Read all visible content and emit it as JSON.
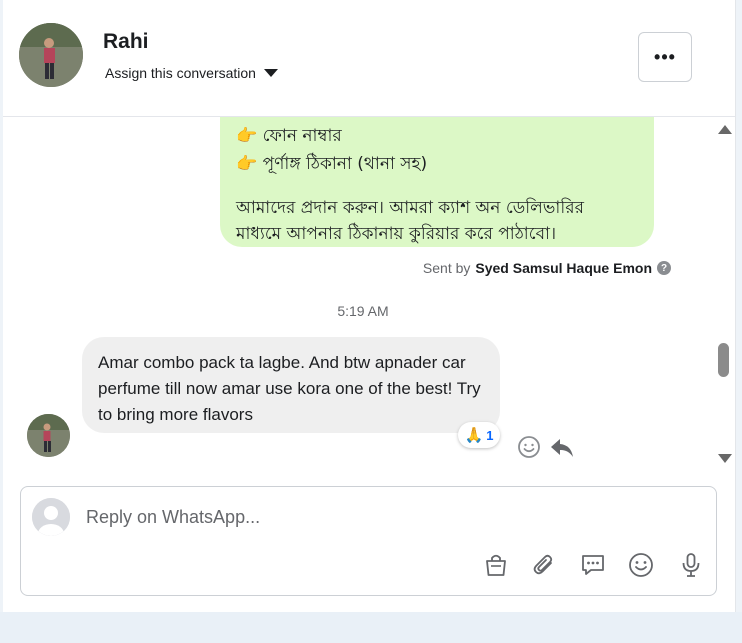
{
  "contact": {
    "name": "Rahi",
    "assign_label": "Assign this conversation"
  },
  "header": {
    "more_label": "•••"
  },
  "outgoing": {
    "line1": "👉 ফোন নাম্বার",
    "line2": "👉  পূর্ণাঙ্গ ঠিকানা (থানা সহ)",
    "line3": "আমাদের প্রদান করুন। আমরা ক্যাশ অন ডেলিভারির",
    "line4": "মাধ্যমে আপনার ঠিকানায় কুরিয়ার করে পাঠাবো।",
    "sent_by_prefix": "Sent by",
    "sent_by_name": "Syed Samsul Haque Emon",
    "help_symbol": "?"
  },
  "timestamp": "5:19 AM",
  "incoming": {
    "text": "Amar combo pack ta lagbe. And btw apnader car perfume till now amar use kora one of the best! Try to bring more flavors",
    "reaction_emoji": "🙏",
    "reaction_count": "1"
  },
  "composer": {
    "placeholder": "Reply on WhatsApp..."
  },
  "colors": {
    "outgoing_bubble": "#dcf8c6",
    "incoming_bubble": "#efefef"
  },
  "icons": [
    "chevron-down-icon",
    "more-icon",
    "help-icon",
    "react-smile-icon",
    "reply-icon",
    "shopping-bag-icon",
    "paperclip-icon",
    "chat-bubble-icon",
    "emoji-icon",
    "microphone-icon"
  ]
}
